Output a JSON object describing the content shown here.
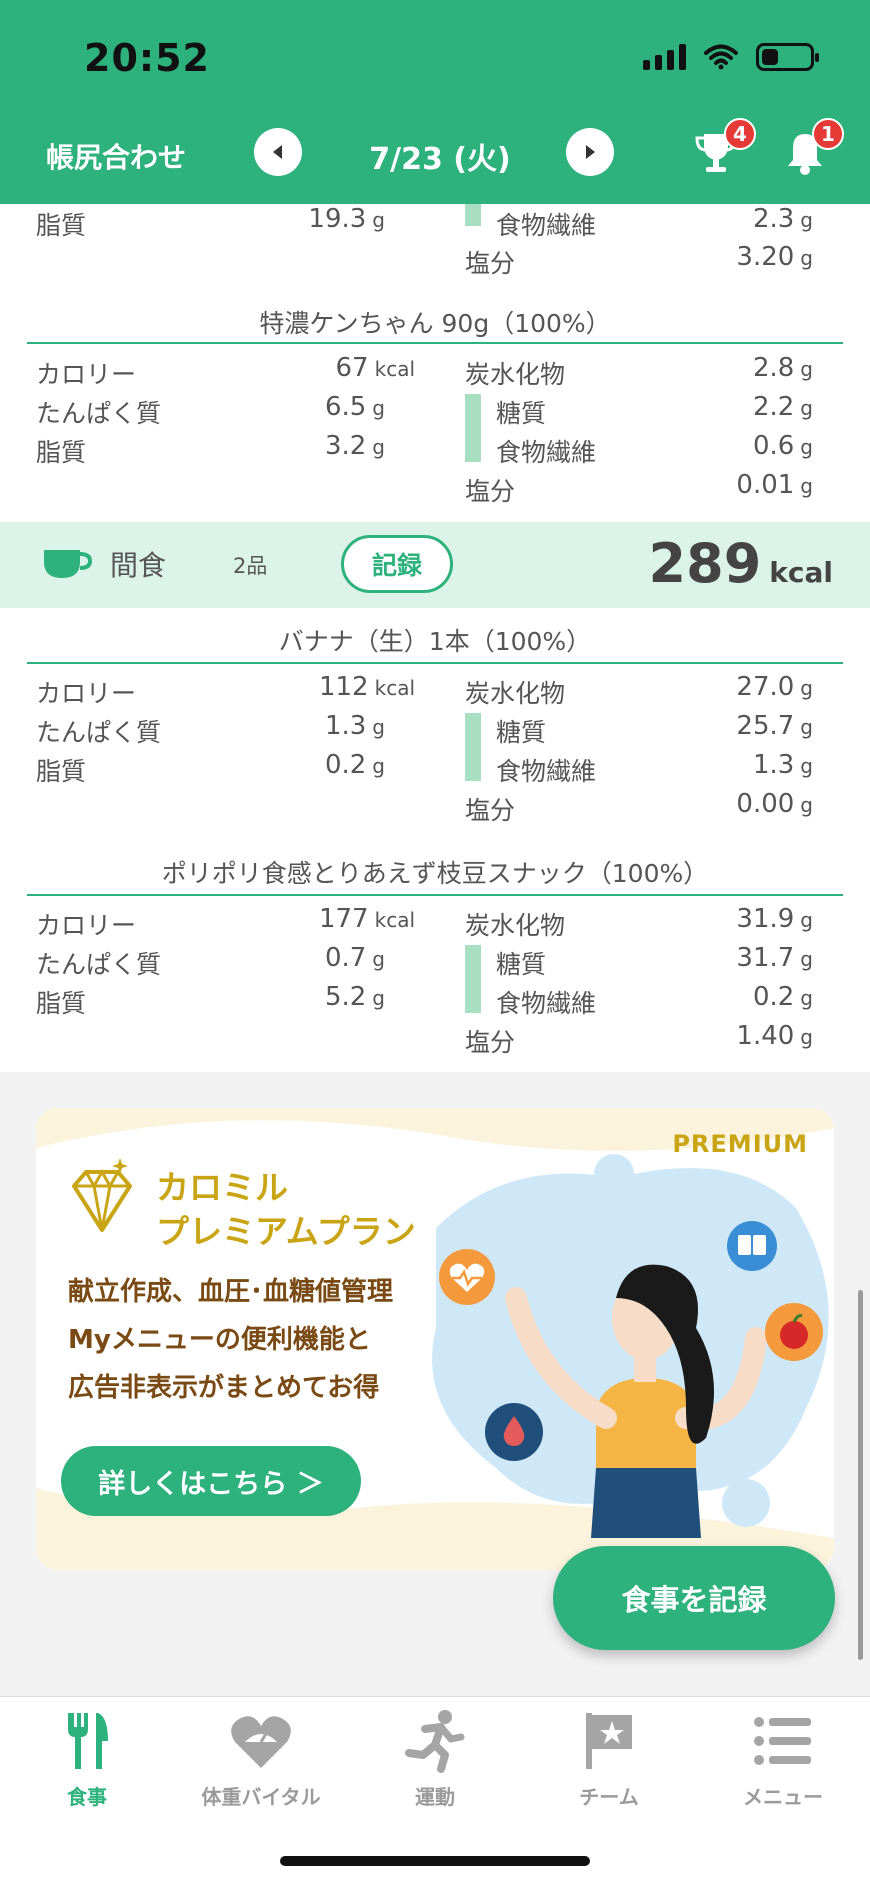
{
  "status": {
    "time": "20:52"
  },
  "header": {
    "title": "帳尻合わせ",
    "date": "7/23 (火)",
    "trophy_badge": "4",
    "bell_badge": "1"
  },
  "top_partial": {
    "fat_label": "脂質",
    "fat_value": "19.3",
    "fat_unit": "g",
    "fiber_label": "食物繊維",
    "fiber_value": "2.3",
    "fiber_unit": "g",
    "salt_label": "塩分",
    "salt_value": "3.20",
    "salt_unit": "g"
  },
  "foods": [
    {
      "title": "特濃ケンちゃん 90g（100%）",
      "calorie_label": "カロリー",
      "calorie": "67",
      "calorie_unit": "kcal",
      "protein_label": "たんぱく質",
      "protein": "6.5",
      "protein_unit": "g",
      "fat_label": "脂質",
      "fat": "3.2",
      "fat_unit": "g",
      "carb_label": "炭水化物",
      "carb": "2.8",
      "carb_unit": "g",
      "sugar_label": "糖質",
      "sugar": "2.2",
      "sugar_unit": "g",
      "fiber_label": "食物繊維",
      "fiber": "0.6",
      "fiber_unit": "g",
      "salt_label": "塩分",
      "salt": "0.01",
      "salt_unit": "g"
    },
    {
      "title": "バナナ（生）1本（100%）",
      "calorie_label": "カロリー",
      "calorie": "112",
      "calorie_unit": "kcal",
      "protein_label": "たんぱく質",
      "protein": "1.3",
      "protein_unit": "g",
      "fat_label": "脂質",
      "fat": "0.2",
      "fat_unit": "g",
      "carb_label": "炭水化物",
      "carb": "27.0",
      "carb_unit": "g",
      "sugar_label": "糖質",
      "sugar": "25.7",
      "sugar_unit": "g",
      "fiber_label": "食物繊維",
      "fiber": "1.3",
      "fiber_unit": "g",
      "salt_label": "塩分",
      "salt": "0.00",
      "salt_unit": "g"
    },
    {
      "title": "ポリポリ食感とりあえず枝豆スナック（100%）",
      "calorie_label": "カロリー",
      "calorie": "177",
      "calorie_unit": "kcal",
      "protein_label": "たんぱく質",
      "protein": "0.7",
      "protein_unit": "g",
      "fat_label": "脂質",
      "fat": "5.2",
      "fat_unit": "g",
      "carb_label": "炭水化物",
      "carb": "31.9",
      "carb_unit": "g",
      "sugar_label": "糖質",
      "sugar": "31.7",
      "sugar_unit": "g",
      "fiber_label": "食物繊維",
      "fiber": "0.2",
      "fiber_unit": "g",
      "salt_label": "塩分",
      "salt": "1.40",
      "salt_unit": "g"
    }
  ],
  "snack": {
    "label": "間食",
    "count": "2品",
    "record_button": "記録",
    "kcal": "289",
    "kcal_unit": "kcal"
  },
  "banner": {
    "tag": "PREMIUM",
    "title_line1": "カロミル",
    "title_line2": "プレミアムプラン",
    "text_line1": "献立作成、血圧･血糖値管理",
    "text_line2": "Myメニューの便利機能と",
    "text_line3": "広告非表示がまとめてお得",
    "button": "詳しくはこちら ＞"
  },
  "fab": {
    "label": "食事を記録"
  },
  "tabs": [
    {
      "label": "食事",
      "icon": "fork-knife-icon",
      "active": true
    },
    {
      "label": "体重バイタル",
      "icon": "heart-scale-icon",
      "active": false
    },
    {
      "label": "運動",
      "icon": "runner-icon",
      "active": false
    },
    {
      "label": "チーム",
      "icon": "flag-icon",
      "active": false
    },
    {
      "label": "メニュー",
      "icon": "menu-list-icon",
      "active": false
    }
  ],
  "colors": {
    "brand": "#2db27d",
    "badge": "#e53935",
    "premium_gold": "#c9a515"
  }
}
